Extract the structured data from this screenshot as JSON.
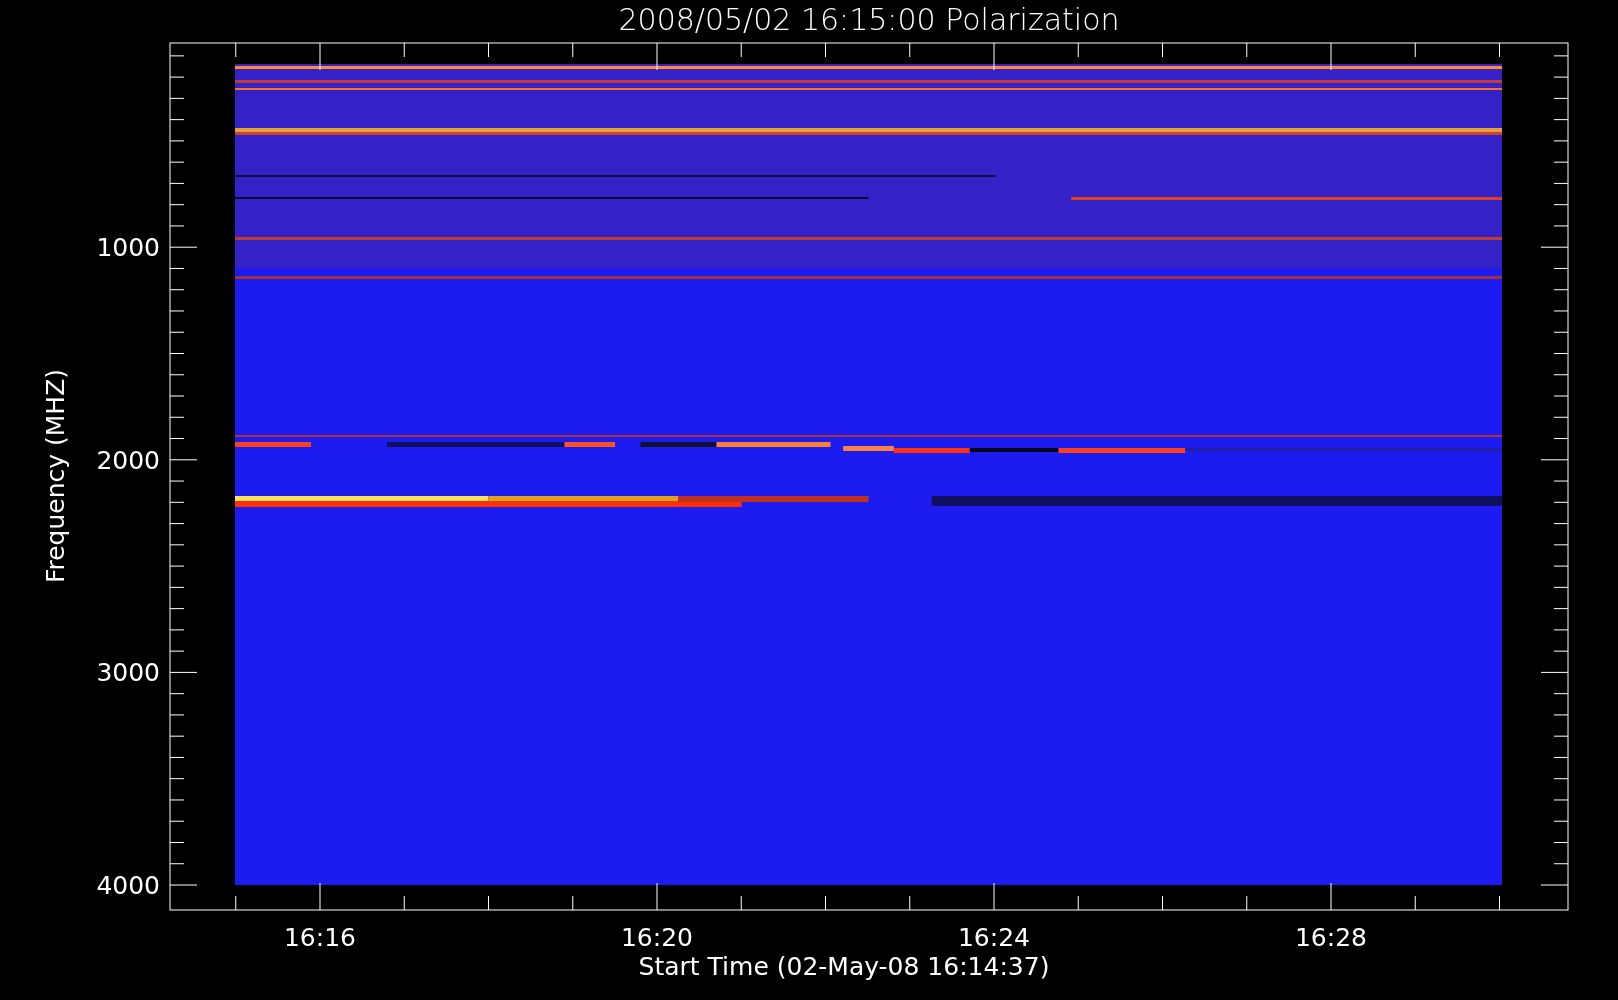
{
  "title": "2008/05/02 16:15:00 Polarization",
  "y_axis": {
    "label": "Frequency (MHZ)",
    "ticks": [
      "1000",
      "2000",
      "3000",
      "4000"
    ]
  },
  "x_axis": {
    "label": "Start Time (02-May-08 16:14:37)",
    "ticks": [
      "16:16",
      "16:20",
      "16:24",
      "16:28"
    ]
  }
}
